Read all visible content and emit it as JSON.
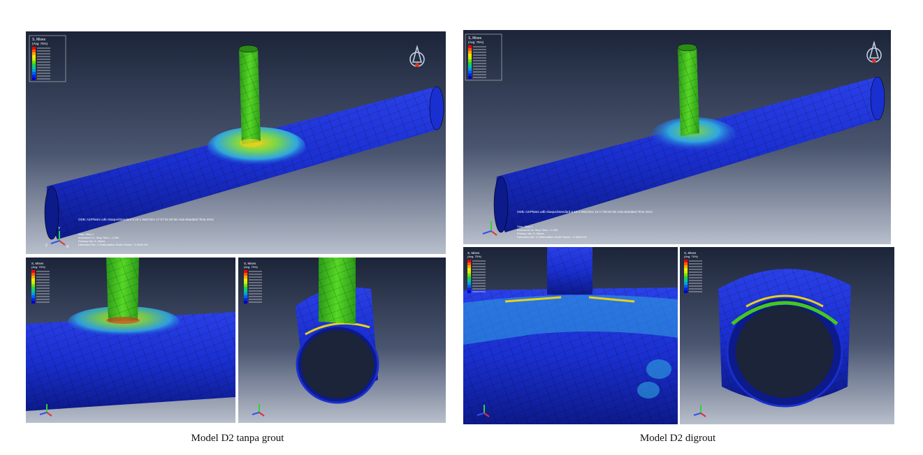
{
  "figure": {
    "left": {
      "caption": "Model D2 tanpa grout",
      "main": {
        "legend_title": "S, Mises",
        "legend_subtitle": "(Avg: 75%)",
        "status_line": "ODB: A2rPlate2.odb   Abaqus/Standard 6.10-1   Wed Dec 17 07:31:49 SE Asia Standard Time 2014",
        "step_line": "Step: Step-1",
        "increment_line": "Increment    21: Step Time =    1.000",
        "primary_var_line": "Primary Var: S, Mises",
        "deformed_var_line": "Deformed Var: U   Deformation Scale Factor: +1.000e+00"
      },
      "detail_a": {
        "legend_title": "S, Mises",
        "legend_subtitle": "(Avg: 75%)"
      },
      "detail_b": {
        "legend_title": "S, Mises",
        "legend_subtitle": "(Avg: 75%)"
      }
    },
    "right": {
      "caption": "Model D2 digrout",
      "main": {
        "legend_title": "S, Mises",
        "legend_subtitle": "(Avg: 75%)",
        "status_line": "ODB: A2rPlate2.odb   Abaqus/Standard 6.10-1   Wed Dec 10 17:09:33 SE Asia Standard Time 2014",
        "step_line": "Step: Step-1",
        "increment_line": "Increment    15: Step Time =    1.000",
        "primary_var_line": "Primary Var: S, Mises",
        "deformed_var_line": "Deformed Var: U   Deformation Scale Factor: +1.000e+00"
      },
      "detail_a": {
        "legend_title": "S, Mises",
        "legend_subtitle": "(Avg: 75%)"
      },
      "detail_b": {
        "legend_title": "S, Mises",
        "legend_subtitle": "(Avg: 75%)"
      }
    }
  },
  "colors": {
    "viewport_top": "#1b2438",
    "viewport_bottom": "#b8bfcc",
    "mesh_blue": "#1a2fd0",
    "mesh_blue_dark": "#0c1a8a",
    "brace_green": "#44c81e",
    "stress_cyan": "#2fa6e0",
    "stress_yellow": "#e8d21c",
    "stress_red": "#e0301c"
  },
  "legend_scale": [
    "#ff0000",
    "#ff5a00",
    "#ffaa00",
    "#ffe600",
    "#c8f000",
    "#78e000",
    "#28d040",
    "#00c8a0",
    "#00a0e0",
    "#0064f0",
    "#0028f0",
    "#0000c8"
  ],
  "icons": [
    "triad-axes-icon",
    "view-cube-icon"
  ]
}
